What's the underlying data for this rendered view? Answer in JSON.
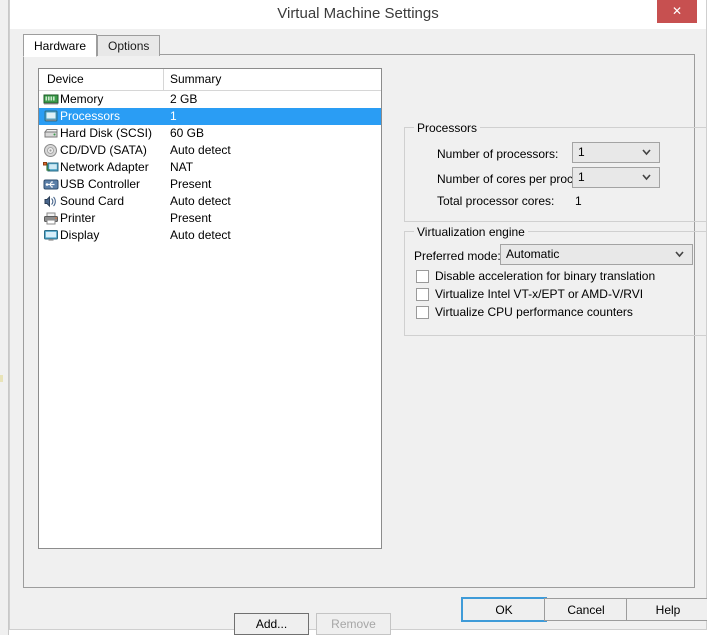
{
  "window": {
    "title": "Virtual Machine Settings",
    "close_label": "✕",
    "close_color": "#c75050"
  },
  "tabs": [
    {
      "label": "Hardware",
      "active": true
    },
    {
      "label": "Options",
      "active": false
    }
  ],
  "device_list": {
    "columns": {
      "device": "Device",
      "summary": "Summary"
    },
    "rows": [
      {
        "icon": "memory-icon",
        "name": "Memory",
        "summary": "2 GB",
        "selected": false
      },
      {
        "icon": "processor-icon",
        "name": "Processors",
        "summary": "1",
        "selected": true
      },
      {
        "icon": "hard-disk-icon",
        "name": "Hard Disk (SCSI)",
        "summary": "60 GB",
        "selected": false
      },
      {
        "icon": "cd-dvd-icon",
        "name": "CD/DVD (SATA)",
        "summary": "Auto detect",
        "selected": false
      },
      {
        "icon": "network-adapter-icon",
        "name": "Network Adapter",
        "summary": "NAT",
        "selected": false
      },
      {
        "icon": "usb-controller-icon",
        "name": "USB Controller",
        "summary": "Present",
        "selected": false
      },
      {
        "icon": "sound-card-icon",
        "name": "Sound Card",
        "summary": "Auto detect",
        "selected": false
      },
      {
        "icon": "printer-icon",
        "name": "Printer",
        "summary": "Present",
        "selected": false
      },
      {
        "icon": "display-icon",
        "name": "Display",
        "summary": "Auto detect",
        "selected": false
      }
    ],
    "selection_color": "#2a9df4"
  },
  "list_buttons": {
    "add_label": "Add...",
    "remove_label": "Remove",
    "remove_disabled": true
  },
  "processors_group": {
    "legend": "Processors",
    "number_of_processors_label": "Number of processors:",
    "number_of_processors_value": "1",
    "cores_per_processor_label": "Number of cores per processor:",
    "cores_per_processor_value": "1",
    "total_cores_label": "Total processor cores:",
    "total_cores_value": "1"
  },
  "virtualization_group": {
    "legend": "Virtualization engine",
    "preferred_mode_label": "Preferred mode:",
    "preferred_mode_value": "Automatic",
    "checkboxes": [
      {
        "label": "Disable acceleration for binary translation",
        "checked": false
      },
      {
        "label": "Virtualize Intel VT-x/EPT or AMD-V/RVI",
        "checked": false
      },
      {
        "label": "Virtualize CPU performance counters",
        "checked": false
      }
    ]
  },
  "footer": {
    "ok_label": "OK",
    "cancel_label": "Cancel",
    "help_label": "Help",
    "default_button_color": "#3f9bd8"
  }
}
